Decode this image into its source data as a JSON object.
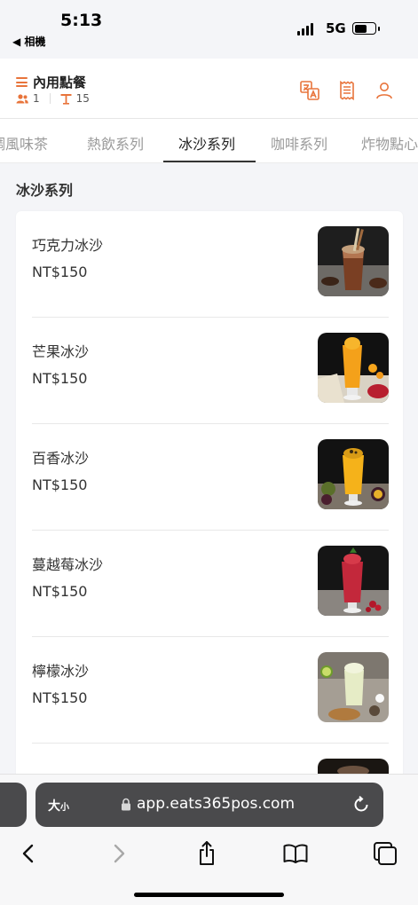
{
  "status_bar": {
    "time": "5:13",
    "back_label": "◀ 相機",
    "network": "5G"
  },
  "header": {
    "title": "內用點餐",
    "guests": "1",
    "table": "15",
    "icons": [
      "translate-icon",
      "receipt-icon",
      "user-icon"
    ]
  },
  "tabs": [
    {
      "label": "調風味茶",
      "active": false
    },
    {
      "label": "熱飲系列",
      "active": false
    },
    {
      "label": "冰沙系列",
      "active": true
    },
    {
      "label": "咖啡系列",
      "active": false
    },
    {
      "label": "炸物點心",
      "active": false
    }
  ],
  "section": {
    "title": "冰沙系列"
  },
  "items": [
    {
      "name": "巧克力冰沙",
      "price": "NT$150",
      "image": "chocolate-smoothie-photo"
    },
    {
      "name": "芒果冰沙",
      "price": "NT$150",
      "image": "mango-smoothie-photo"
    },
    {
      "name": "百香冰沙",
      "price": "NT$150",
      "image": "passionfruit-smoothie-photo"
    },
    {
      "name": "蔓越莓冰沙",
      "price": "NT$150",
      "image": "cranberry-smoothie-photo"
    },
    {
      "name": "檸檬冰沙",
      "price": "NT$150",
      "image": "lemon-smoothie-photo"
    },
    {
      "name": "",
      "price": "",
      "image": "partial-smoothie-photo"
    }
  ],
  "browser": {
    "text_size_label": "大",
    "text_size_small": "小",
    "url": "app.eats365pos.com"
  },
  "colors": {
    "accent": "#e8743b",
    "text": "#333333",
    "tab_inactive": "#9a9a9a",
    "background": "#f4f5f8",
    "url_bar": "#4a4a4c"
  }
}
